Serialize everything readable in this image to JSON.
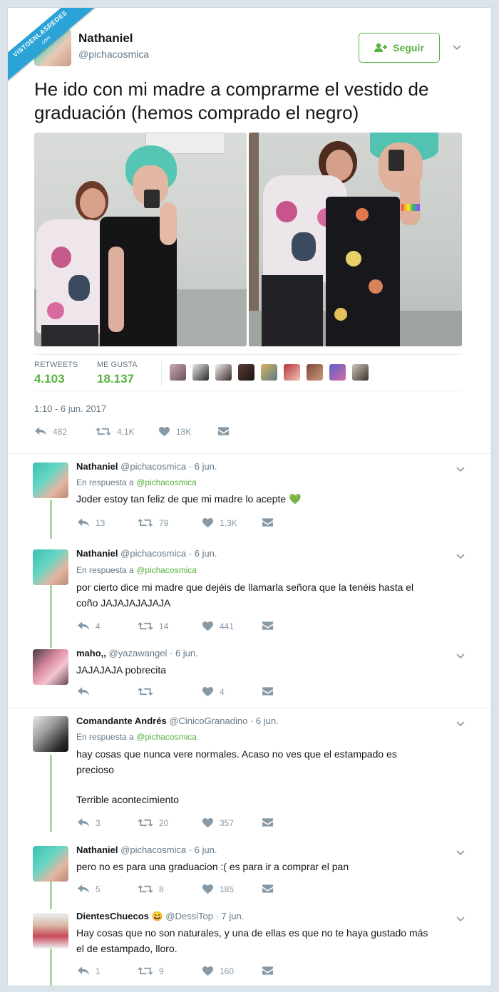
{
  "watermark": {
    "line1": "VISTOENLASREDES",
    "line2": ".com"
  },
  "colors": {
    "accent": "#55b240",
    "muted": "#657786",
    "thread": "#a6dd9c"
  },
  "tweet": {
    "name": "Nathaniel",
    "handle": "@pichacosmica",
    "follow_label": "Seguir",
    "text": "He ido con mi madre a comprarme el vestido de graduación (hemos comprado el negro)",
    "retweets_label": "RETWEETS",
    "retweets_value": "4.103",
    "likes_label": "ME GUSTA",
    "likes_value": "18.137",
    "timestamp": "1:10 - 6 jun. 2017",
    "actions": {
      "reply": "482",
      "retweet": "4,1K",
      "like": "18K"
    }
  },
  "replies": [
    {
      "name": "Nathaniel",
      "handle": "@pichacosmica",
      "date": "· 6 jun.",
      "in_reply_prefix": "En respuesta a",
      "in_reply_handle": "@pichacosmica",
      "text": "Joder estoy tan feliz de que mi madre lo acepte 💚",
      "reply": "13",
      "retweet": "79",
      "like": "1,3K"
    },
    {
      "name": "Nathaniel",
      "handle": "@pichacosmica",
      "date": "· 6 jun.",
      "in_reply_prefix": "En respuesta a",
      "in_reply_handle": "@pichacosmica",
      "text_lines": [
        "por cierto dice mi madre que dejéis de llamarla señora que la tenéis hasta el",
        "coño JAJAJAJAJAJA"
      ],
      "reply": "4",
      "retweet": "14",
      "like": "441"
    },
    {
      "name": "maho,,",
      "handle": "@yazawangel",
      "date": "· 6 jun.",
      "text": "JAJAJAJA pobrecita",
      "reply": "",
      "retweet": "",
      "like": "4"
    },
    {
      "name": "Comandante Andrés",
      "handle": "@CinicoGranadino",
      "date": "· 6 jun.",
      "in_reply_prefix": "En respuesta a",
      "in_reply_handle": "@pichacosmica",
      "text_lines": [
        "hay cosas que nunca vere normales. Acaso no ves que el estampado es",
        "precioso",
        "Terrible acontecimiento"
      ],
      "reply": "3",
      "retweet": "20",
      "like": "357"
    },
    {
      "name": "Nathaniel",
      "handle": "@pichacosmica",
      "date": "· 6 jun.",
      "text": "pero no es para una graduacion :( es para ir a comprar el pan",
      "reply": "5",
      "retweet": "8",
      "like": "185"
    },
    {
      "name": "DientesChuecos 😄",
      "handle": "@DessiTop",
      "date": "· 7 jun.",
      "text_lines": [
        "Hay cosas que no son naturales, y una de ellas es que no te haya gustado más",
        "el de estampado, lloro."
      ],
      "reply": "1",
      "retweet": "9",
      "like": "160"
    }
  ]
}
